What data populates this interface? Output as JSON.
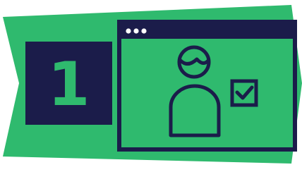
{
  "step": {
    "number": "1"
  },
  "colors": {
    "background": "#ffffff",
    "banner_green": "#2fba6e",
    "ink_navy": "#1b1c4a"
  },
  "icons": {
    "banner": "arrow-chevron-banner",
    "window": "browser-window-icon",
    "window_dots": "window-control-dots-icon",
    "user": "user-avatar-icon",
    "checkbox": "checked-checkbox-icon"
  }
}
